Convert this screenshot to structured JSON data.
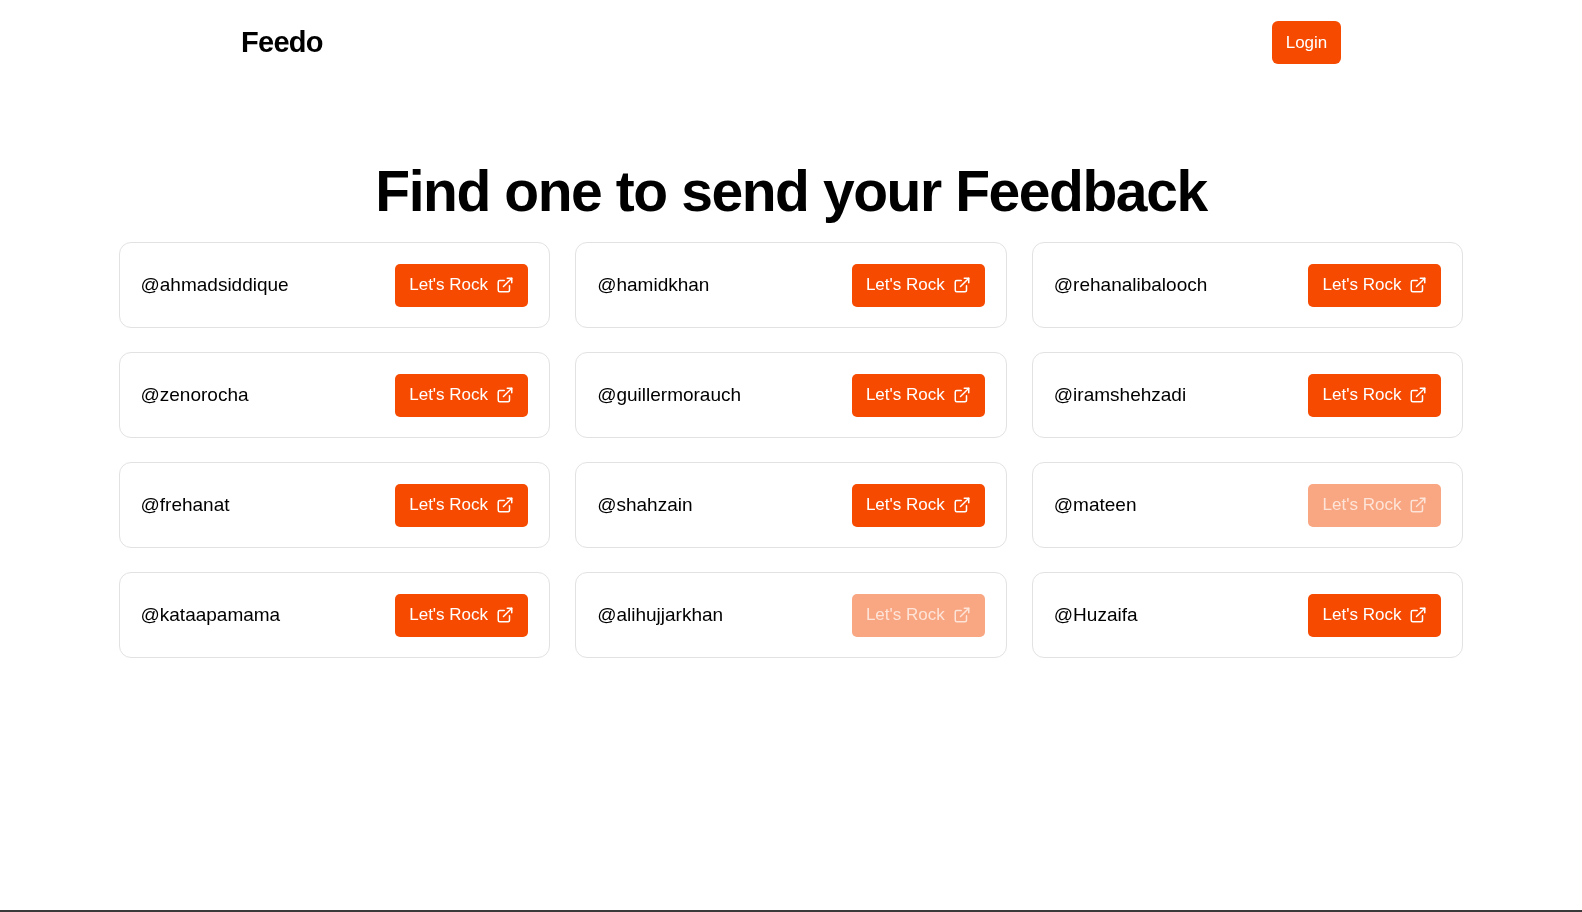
{
  "header": {
    "logo": "Feedo",
    "login_button": "Login"
  },
  "heading": "Find one to send your Feedback",
  "users": [
    {
      "handle": "@ahmadsiddique",
      "button": "Let's Rock",
      "disabled": false
    },
    {
      "handle": "@hamidkhan",
      "button": "Let's Rock",
      "disabled": false
    },
    {
      "handle": "@rehanalibalooch",
      "button": "Let's Rock",
      "disabled": false
    },
    {
      "handle": "@zenorocha",
      "button": "Let's Rock",
      "disabled": false
    },
    {
      "handle": "@guillermorauch",
      "button": "Let's Rock",
      "disabled": false
    },
    {
      "handle": "@iramshehzadi",
      "button": "Let's Rock",
      "disabled": false
    },
    {
      "handle": "@frehanat",
      "button": "Let's Rock",
      "disabled": false
    },
    {
      "handle": "@shahzain",
      "button": "Let's Rock",
      "disabled": false
    },
    {
      "handle": "@mateen",
      "button": "Let's Rock",
      "disabled": true
    },
    {
      "handle": "@kataapamama",
      "button": "Let's Rock",
      "disabled": false
    },
    {
      "handle": "@alihujjarkhan",
      "button": "Let's Rock",
      "disabled": true
    },
    {
      "handle": "@Huzaifa",
      "button": "Let's Rock",
      "disabled": false
    }
  ]
}
